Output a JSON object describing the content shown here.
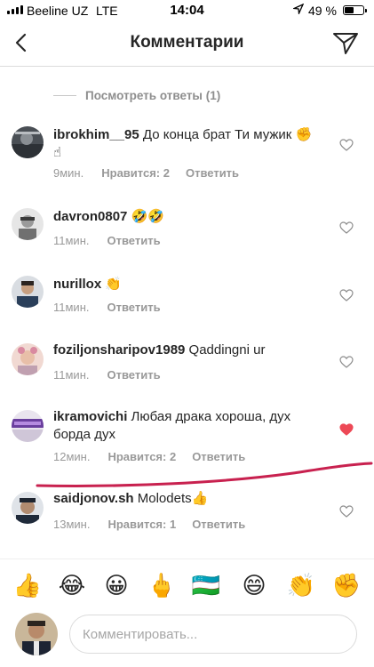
{
  "status_bar": {
    "carrier": "Beeline UZ",
    "network": "LTE",
    "time": "14:04",
    "battery": "49 %",
    "battery_level": 0.49
  },
  "header": {
    "title": "Комментарии",
    "back_icon": "chevron-left-icon",
    "share_icon": "paper-plane-icon"
  },
  "view_replies": "Посмотреть ответы (1)",
  "comments": [
    {
      "user": "ibrokhim__95",
      "text": "До конца брат Ти мужик ✊☝",
      "time": "9мин.",
      "likes": "Нравится: 2",
      "reply": "Ответить",
      "liked": false
    },
    {
      "user": "davron0807",
      "text": "🤣🤣",
      "time": "11мин.",
      "likes": "",
      "reply": "Ответить",
      "liked": false
    },
    {
      "user": "nurillox",
      "text": "👏",
      "time": "11мин.",
      "likes": "",
      "reply": "Ответить",
      "liked": false
    },
    {
      "user": "foziljonsharipov1989",
      "text": "Qaddingni ur",
      "time": "11мин.",
      "likes": "",
      "reply": "Ответить",
      "liked": false
    },
    {
      "user": "ikramovichi",
      "text": "Любая драка хороша, дух борда дух",
      "time": "12мин.",
      "likes": "Нравится: 2",
      "reply": "Ответить",
      "liked": true
    },
    {
      "user": "saidjonov.sh",
      "text": "Molodets👍",
      "time": "13мин.",
      "likes": "Нравится: 1",
      "reply": "Ответить",
      "liked": false
    }
  ],
  "emoji_bar": [
    "👍",
    "😂",
    "😀",
    "🖕",
    "🇺🇿",
    "😄",
    "👏",
    "✊"
  ],
  "composer": {
    "placeholder": "Комментировать..."
  },
  "colors": {
    "text": "#262626",
    "meta": "#999999",
    "heart_liked": "#ed4956",
    "annotation_stroke": "#c8214f"
  }
}
